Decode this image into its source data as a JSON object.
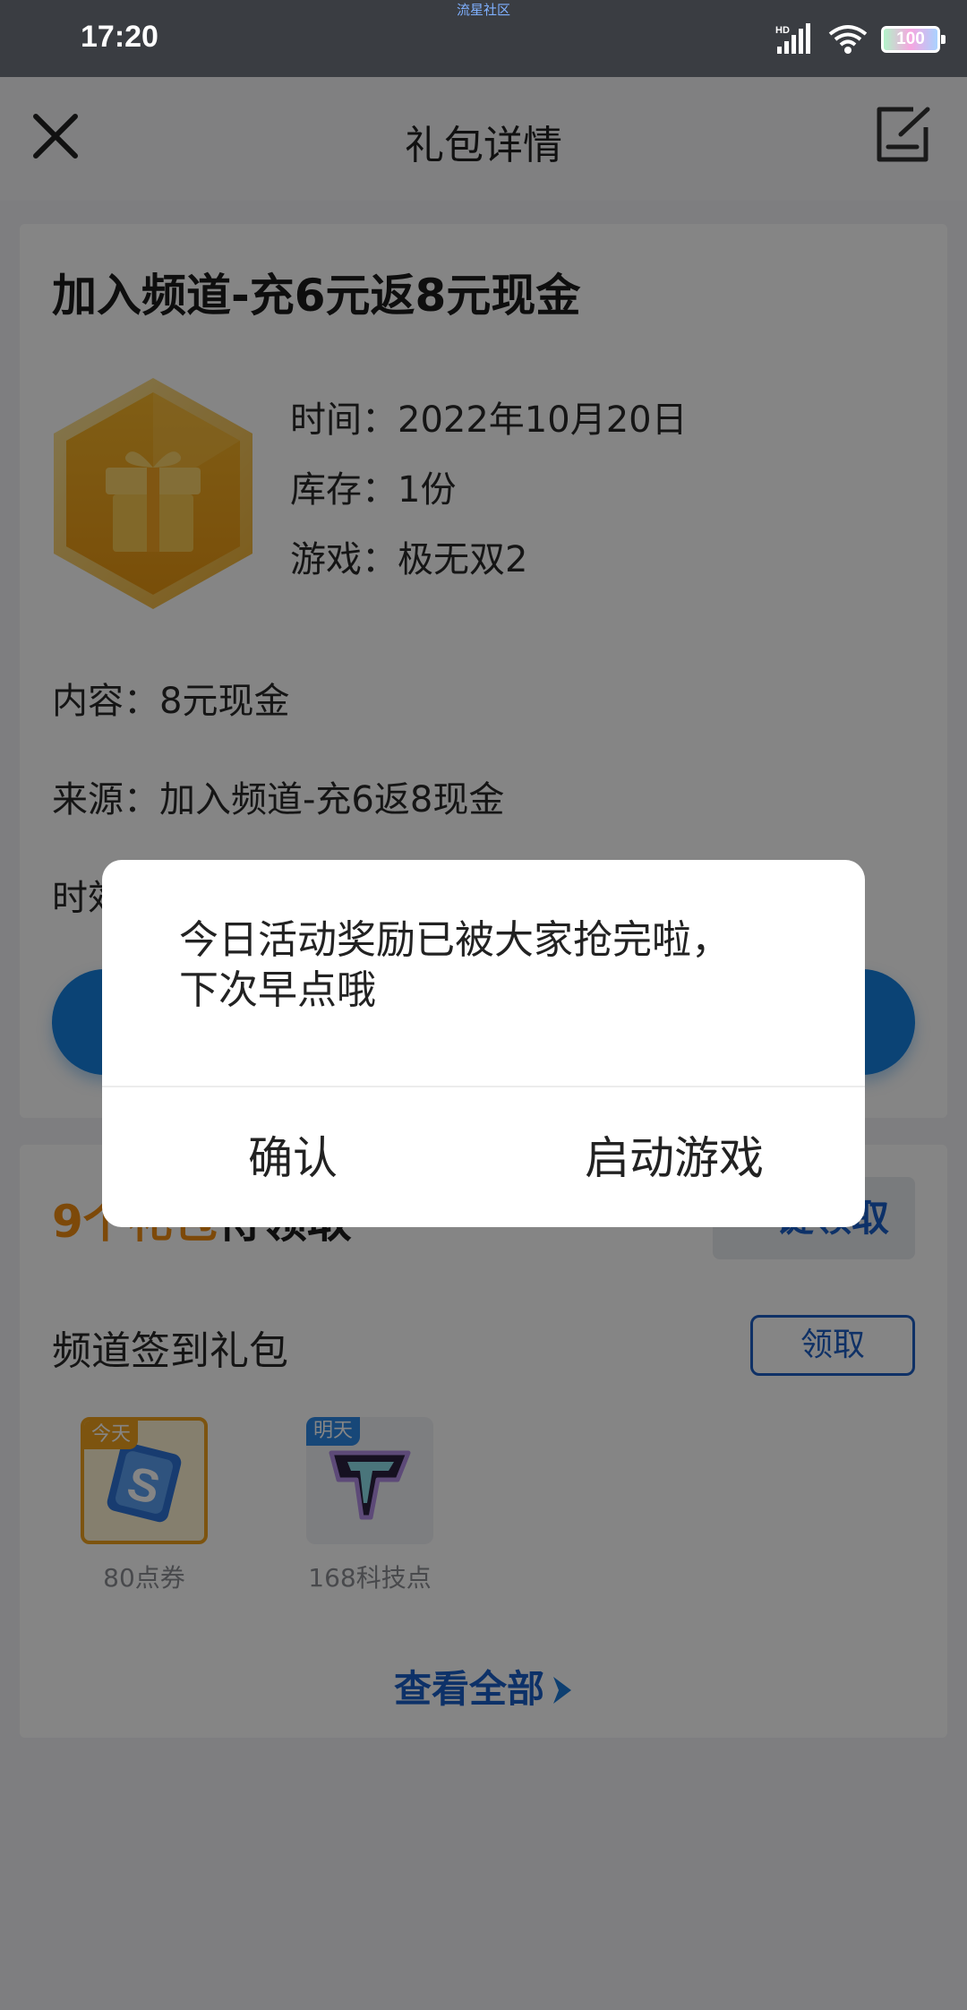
{
  "status_bar": {
    "time": "17:20",
    "tiny_label": "流星社区",
    "battery": "100",
    "icons": [
      "hd-signal-icon",
      "wifi-icon",
      "battery-icon"
    ]
  },
  "header": {
    "title": "礼包详情",
    "close_icon": "close-icon",
    "edit_icon": "edit-note-icon"
  },
  "gift": {
    "title": "加入频道-充6元返8元现金",
    "time": "时间：2022年10月20日",
    "stock": "库存：1份",
    "game": "游戏：极无双2",
    "content": "内容：8元现金",
    "source": "来源：加入频道-充6返8现金",
    "validity_label": "时效"
  },
  "pending": {
    "count": "9个",
    "highlight": "礼包",
    "suffix": "待领取",
    "claim_all": "一键领取"
  },
  "signin": {
    "title": "频道签到礼包",
    "claim": "领取",
    "rewards": [
      {
        "tag": "今天",
        "label": "80点券",
        "icon": "coupon-s-icon"
      },
      {
        "tag": "明天",
        "label": "168科技点",
        "icon": "tech-point-t-icon"
      }
    ],
    "view_all": "查看全部"
  },
  "dialog": {
    "message_line1": "今日活动奖励已被大家抢完啦，",
    "message_line2": "下次早点哦",
    "confirm": "确认",
    "launch": "启动游戏"
  },
  "colors": {
    "accent_blue": "#1681e0",
    "link_blue": "#1a5fc7",
    "orange": "#f08c12",
    "gold": "#f0a21e"
  }
}
